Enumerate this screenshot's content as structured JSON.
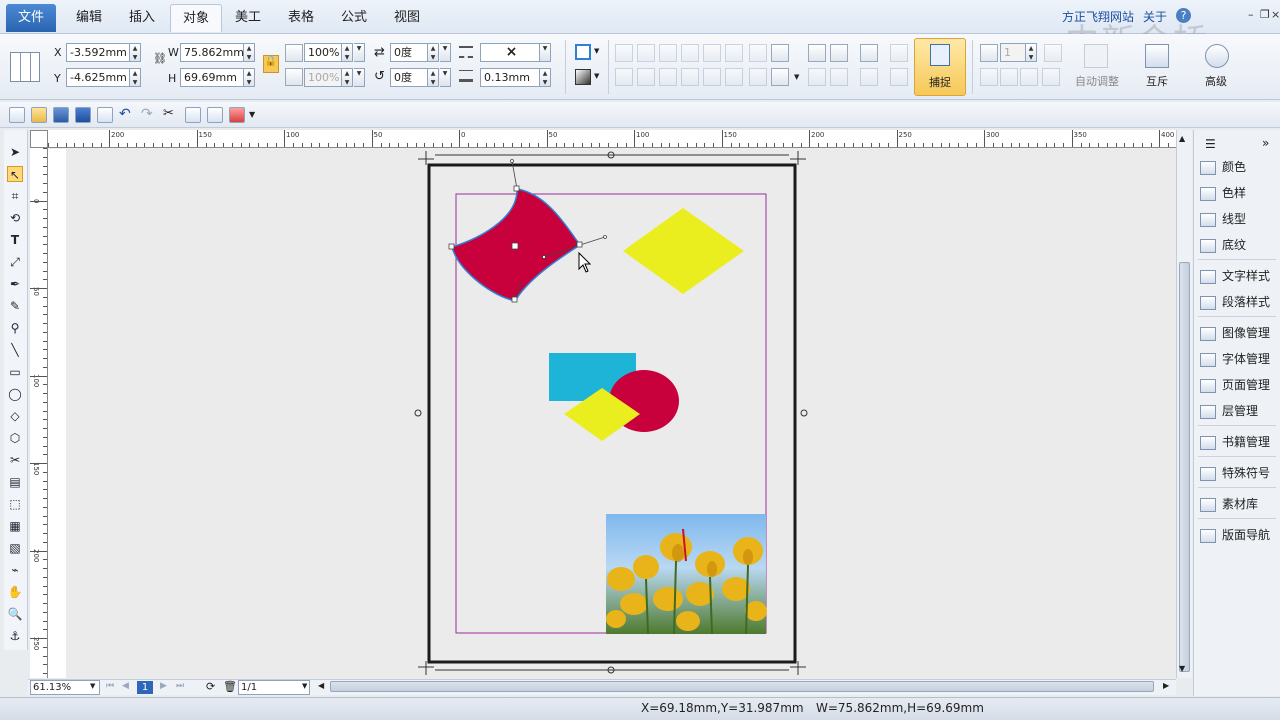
{
  "menu": {
    "file": "文件",
    "edit": "编辑",
    "insert": "插入",
    "object": "对象",
    "art": "美工",
    "table": "表格",
    "formula": "公式",
    "view": "视图"
  },
  "header": {
    "brand_link": "方正飞翔网站",
    "about": "关于",
    "watermark": "中新金桥"
  },
  "ribbon": {
    "x_label": "X",
    "y_label": "Y",
    "w_label": "W",
    "h_label": "H",
    "x_value": "-3.592mm",
    "y_value": "-4.625mm",
    "w_value": "75.862mm",
    "h_value": "69.69mm",
    "scale_x": "100%",
    "scale_y": "100%",
    "rotate": "0度",
    "skew": "0度",
    "line_style": "×",
    "line_width": "0.13mm",
    "column_count": "1",
    "capture_label": "捕捉",
    "auto_adjust_label": "自动调整",
    "exclusive_label": "互斥",
    "advanced_label": "高级"
  },
  "ruler": {
    "h_ticks": [
      "200",
      "150",
      "100",
      "50",
      "0",
      "50",
      "100",
      "150",
      "200",
      "250",
      "300",
      "350",
      "400"
    ],
    "v_ticks": [
      "0",
      "50",
      "100",
      "150",
      "200",
      "250"
    ]
  },
  "panel": {
    "items": [
      {
        "label": "颜色",
        "icon": "color-swatch-icon"
      },
      {
        "label": "色样",
        "icon": "color-sample-icon"
      },
      {
        "label": "线型",
        "icon": "line-type-icon"
      },
      {
        "label": "底纹",
        "icon": "pattern-icon"
      },
      {
        "label": "文字样式",
        "icon": "text-style-icon"
      },
      {
        "label": "段落样式",
        "icon": "paragraph-style-icon"
      },
      {
        "label": "图像管理",
        "icon": "image-manager-icon"
      },
      {
        "label": "字体管理",
        "icon": "font-manager-icon"
      },
      {
        "label": "页面管理",
        "icon": "page-manager-icon"
      },
      {
        "label": "层管理",
        "icon": "layer-manager-icon"
      },
      {
        "label": "书籍管理",
        "icon": "book-manager-icon"
      },
      {
        "label": "特殊符号",
        "icon": "special-symbol-icon"
      },
      {
        "label": "素材库",
        "icon": "asset-library-icon"
      },
      {
        "label": "版面导航",
        "icon": "layout-navigator-icon"
      }
    ]
  },
  "bottom": {
    "zoom": "61.13%",
    "current_page": "1",
    "page_of": "1/1"
  },
  "status": {
    "cursor_xy": "X=69.18mm,Y=31.987mm",
    "size_wh": "W=75.862mm,H=69.69mm"
  },
  "colors": {
    "crimson": "#c8003c",
    "yellow": "#eaee1e",
    "cyan": "#1eb4d8",
    "selection": "#2f7fd6",
    "margin_guide": "#9b2d9b"
  }
}
